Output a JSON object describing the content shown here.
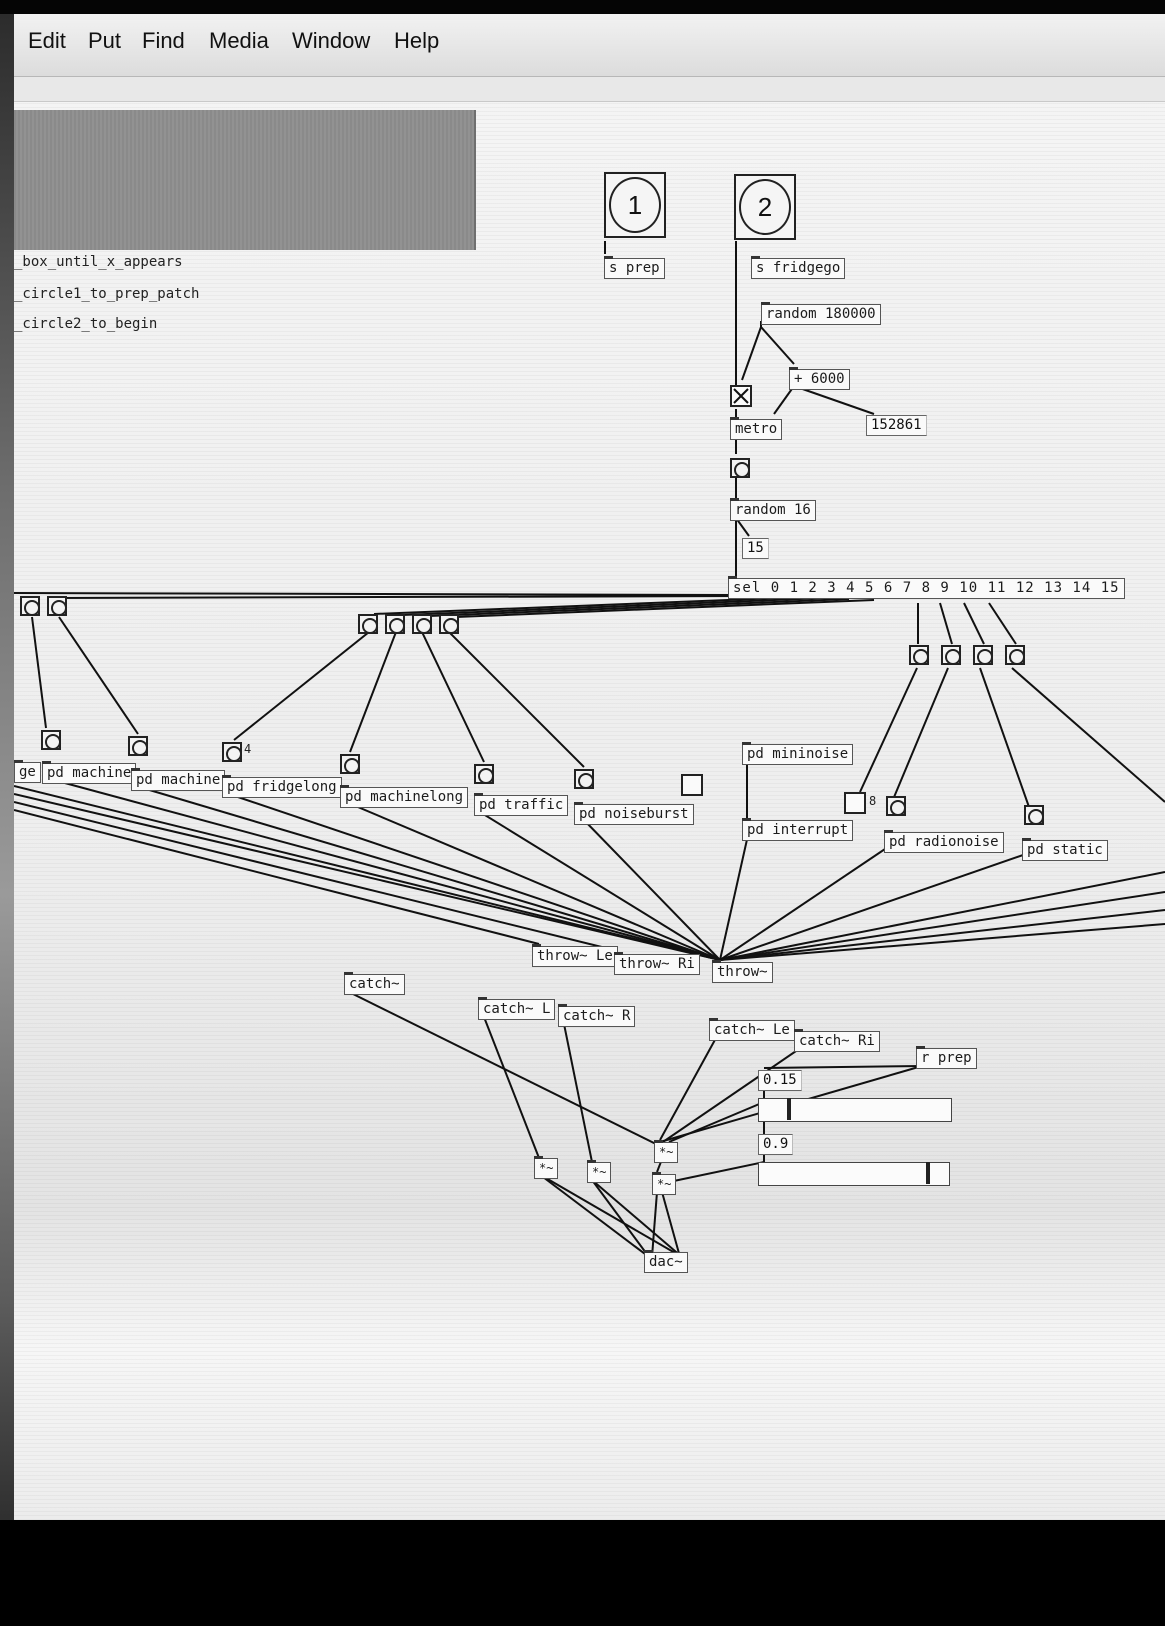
{
  "menu": [
    "Edit",
    "Put",
    "Find",
    "Media",
    "Window",
    "Help"
  ],
  "instructions": [
    "_box_until_x_appears",
    "_circle1_to_prep_patch",
    "_circle2_to_begin"
  ],
  "big_bangs": {
    "one": "1",
    "two": "2"
  },
  "objects": {
    "s_prep": "s prep",
    "s_fridgego": "s fridgego",
    "random_big": "random 180000",
    "plus_6000": "+ 6000",
    "metro": "metro",
    "random_16": "random 16",
    "sel": "sel 0 1 2 3 4 5 6 7 8 9 10 11 12 13 14 15",
    "mininoise": "pd mininoise",
    "interrupt": "pd interrupt",
    "radionoise": "pd radionoise",
    "static": "pd static",
    "ge": "ge",
    "machine1": "pd machine",
    "machine2": "pd machine",
    "fridgelong": "pd fridgelong",
    "machinelong": "pd machinelong",
    "traffic": "pd traffic",
    "noiseburst": "pd noiseburst",
    "throw_le": "throw~ Le",
    "throw_ri": "throw~ Ri",
    "throw": "throw~",
    "catch": "catch~",
    "catch_l": "catch~ L",
    "catch_r": "catch~ R",
    "catch_le": "catch~ Le",
    "catch_ri": "catch~ Ri",
    "r_prep": "r prep",
    "mul1": "*~",
    "mul2": "*~",
    "mul3": "*~",
    "mul4": "*~",
    "dac": "dac~"
  },
  "numbers": {
    "metro_time": "152861",
    "random_out": "15",
    "vol_a": "0.15",
    "vol_b": "0.9"
  },
  "badges": {
    "fridgelong_badge": "4",
    "interrupt_badge": "8"
  },
  "sliders": {
    "vol_a_level": 0.15,
    "vol_b_level": 0.9
  }
}
